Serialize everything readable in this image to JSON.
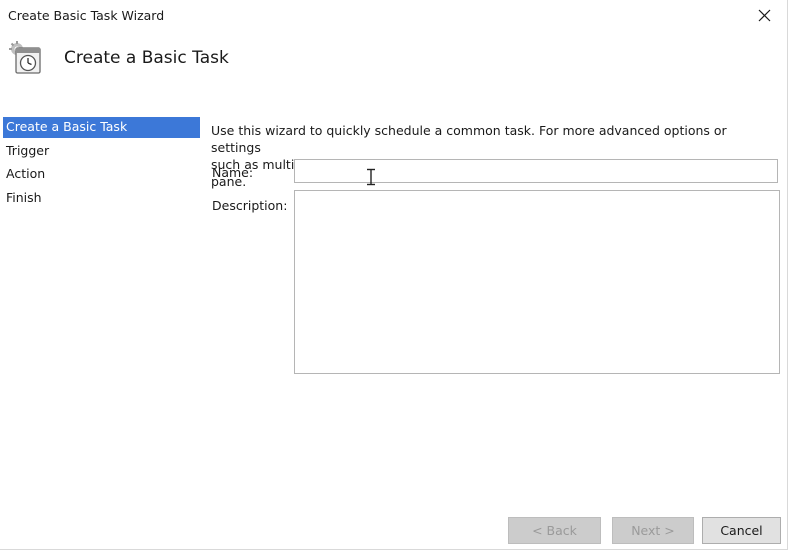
{
  "window": {
    "title": "Create Basic Task Wizard",
    "close_glyph": "✕"
  },
  "header": {
    "icon": "task-scheduler-clock-icon",
    "title": "Create a Basic Task"
  },
  "steps": {
    "items": [
      {
        "label": "Create a Basic Task",
        "active": true
      },
      {
        "label": "Trigger",
        "active": false
      },
      {
        "label": "Action",
        "active": false
      },
      {
        "label": "Finish",
        "active": false
      }
    ]
  },
  "form": {
    "intro_line1": "Use this wizard to quickly schedule a common task.  For more advanced options or settings",
    "intro_line2": "such as multiple task actions or triggers, use the Create Task command in the Actions pane.",
    "name_label": "Name:",
    "name_value": "",
    "description_label": "Description:",
    "description_value": ""
  },
  "buttons": {
    "back_label": "< Back",
    "next_label": "Next >",
    "cancel_label": "Cancel",
    "back_enabled": false,
    "next_enabled": false
  },
  "colors": {
    "selection": "#3c78d8",
    "disabled_button_bg": "#cccccc",
    "button_bg": "#e1e1e1"
  }
}
